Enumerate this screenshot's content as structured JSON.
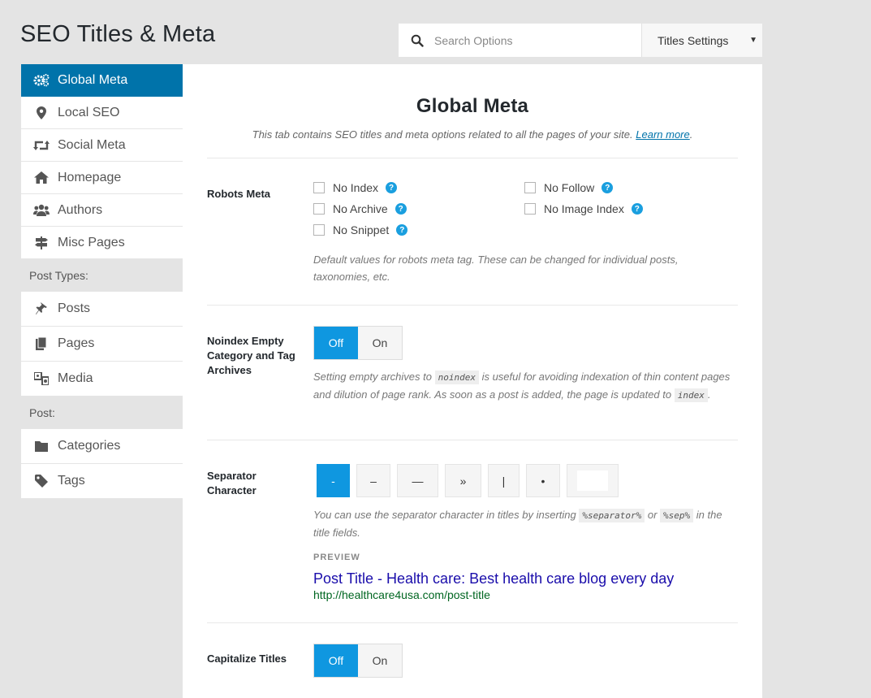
{
  "page_title": "SEO Titles & Meta",
  "search": {
    "placeholder": "Search Options"
  },
  "settings_select": {
    "value": "Titles Settings"
  },
  "sidebar": {
    "items": [
      {
        "label": "Global Meta",
        "icon": "gears-icon"
      },
      {
        "label": "Local SEO",
        "icon": "map-marker-icon"
      },
      {
        "label": "Social Meta",
        "icon": "retweet-icon"
      },
      {
        "label": "Homepage",
        "icon": "home-icon"
      },
      {
        "label": "Authors",
        "icon": "users-icon"
      },
      {
        "label": "Misc Pages",
        "icon": "signpost-icon"
      }
    ],
    "group_post_types": "Post Types:",
    "post_types": [
      {
        "label": "Posts",
        "icon": "pin-icon"
      },
      {
        "label": "Pages",
        "icon": "pages-icon"
      },
      {
        "label": "Media",
        "icon": "media-icon"
      }
    ],
    "group_post": "Post:",
    "post": [
      {
        "label": "Categories",
        "icon": "folder-icon"
      },
      {
        "label": "Tags",
        "icon": "tag-icon"
      }
    ]
  },
  "main": {
    "title": "Global Meta",
    "description": "This tab contains SEO titles and meta options related to all the pages of your site.",
    "learn_more": "Learn more",
    "robots": {
      "label": "Robots Meta",
      "options": [
        "No Index",
        "No Follow",
        "No Archive",
        "No Image Index",
        "No Snippet"
      ],
      "desc": "Default values for robots meta tag. These can be changed for individual posts, taxonomies, etc."
    },
    "noindex": {
      "label": "Noindex Empty Category and Tag Archives",
      "off": "Off",
      "on": "On",
      "desc_1": "Setting empty archives to",
      "code_1": "noindex",
      "desc_2": "is useful for avoiding indexation of thin content pages and dilution of page rank. As soon as a post is added, the page is updated to",
      "code_2": "index",
      "desc_3": "."
    },
    "separator": {
      "label": "Separator Character",
      "options": [
        "-",
        "–",
        "—",
        "»",
        "|",
        "•",
        ""
      ],
      "desc_1": "You can use the separator character in titles by inserting",
      "code_1": "%separator%",
      "desc_2": "or",
      "code_2": "%sep%",
      "desc_3": "in the title fields.",
      "preview_label": "PREVIEW",
      "preview_title": "Post Title - Health care: Best health care blog every day",
      "preview_url": "http://healthcare4usa.com/post-title"
    },
    "capitalize": {
      "label": "Capitalize Titles",
      "off": "Off",
      "on": "On"
    }
  },
  "colors": {
    "accent": "#0073aa",
    "toggle_on": "#0f97e0",
    "help": "#1a9fdf"
  }
}
